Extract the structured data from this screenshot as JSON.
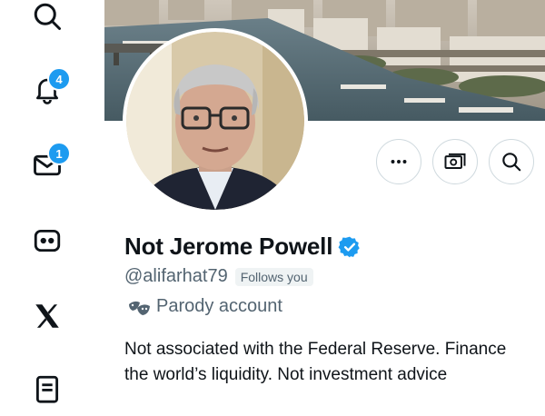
{
  "sidebar": {
    "items": [
      {
        "icon": "search-icon"
      },
      {
        "icon": "bell-icon",
        "badge": "4"
      },
      {
        "icon": "mail-icon",
        "badge": "1"
      },
      {
        "icon": "grok-icon"
      },
      {
        "icon": "x-logo-icon"
      },
      {
        "icon": "list-icon"
      }
    ]
  },
  "profile": {
    "display_name": "Not Jerome Powell",
    "handle": "@alifarhat79",
    "follows_you": "Follows you",
    "parody_label": "Parody account",
    "bio_line1": "Not associated with the Federal Reserve. Finance",
    "bio_line2": "the world’s liquidity. Not investment advice"
  },
  "actions": [
    {
      "icon": "more-icon"
    },
    {
      "icon": "money-icon"
    },
    {
      "icon": "search-icon"
    }
  ],
  "colors": {
    "accent": "#1d9bf0",
    "text_primary": "#0f1419",
    "text_secondary": "#536471"
  }
}
